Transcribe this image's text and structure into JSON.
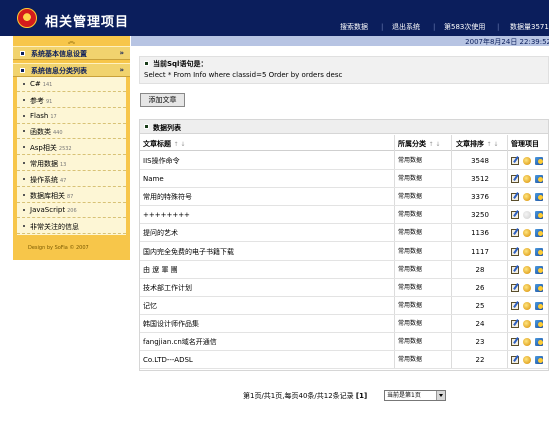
{
  "header": {
    "title": "相关管理项目",
    "nav": [
      "搜索数据",
      "退出系统",
      "第583次使用",
      "数据量3571"
    ],
    "datetime": "2007年8月24日  22:39:52"
  },
  "sidebar": {
    "collapse_icon": "chevron-double-up",
    "sections": [
      "系统基本信息设置",
      "系统信息分类列表"
    ],
    "section_chevron": "»",
    "items": [
      {
        "label": "C#",
        "count": "141"
      },
      {
        "label": "参考",
        "count": "91"
      },
      {
        "label": "Flash",
        "count": "17"
      },
      {
        "label": "函数类",
        "count": "440"
      },
      {
        "label": "Asp相关",
        "count": "2532"
      },
      {
        "label": "常用数据",
        "count": "13"
      },
      {
        "label": "操作系统",
        "count": "47"
      },
      {
        "label": "数据库相关",
        "count": "87"
      },
      {
        "label": "JavaScript",
        "count": "206"
      },
      {
        "label": "非常关注的信息",
        "count": ""
      }
    ],
    "copyright": "Design by SoFia © 2007"
  },
  "sql": {
    "heading": "当前Sql语句是：",
    "query": "Select * From Info where classid=5 Order by orders desc"
  },
  "add_button": "添加文章",
  "table": {
    "caption": "数据列表",
    "columns": [
      "文章标题",
      "所属分类",
      "文章排序",
      "管理项目"
    ],
    "sort_arrows": "↑ ↓",
    "rows": [
      {
        "title": "IIS操作命令",
        "category": "常用数据",
        "order": "3548",
        "star": true
      },
      {
        "title": "Name",
        "category": "常用数据",
        "order": "3512",
        "star": true
      },
      {
        "title": "常用的特殊符号",
        "category": "常用数据",
        "order": "3376",
        "star": true
      },
      {
        "title": "++++++++",
        "category": "常用数据",
        "order": "3250",
        "star": false
      },
      {
        "title": "提问的艺术",
        "category": "常用数据",
        "order": "1136",
        "star": true
      },
      {
        "title": "国内完全免费的电子书籍下载",
        "category": "常用数据",
        "order": "1117",
        "star": true
      },
      {
        "title": "由 遼 軍 團",
        "category": "常用数据",
        "order": "28",
        "star": true
      },
      {
        "title": "技术部工作计划",
        "category": "常用数据",
        "order": "26",
        "star": true
      },
      {
        "title": "记忆",
        "category": "常用数据",
        "order": "25",
        "star": true
      },
      {
        "title": "韩国设计师作品集",
        "category": "常用数据",
        "order": "24",
        "star": true
      },
      {
        "title": "fangjian.cn域名开通信",
        "category": "常用数据",
        "order": "23",
        "star": true
      },
      {
        "title": "Co.LTD---ADSL",
        "category": "常用数据",
        "order": "22",
        "star": true
      }
    ]
  },
  "pager": {
    "text": "第1页/共1页,每页40条/共12条记录",
    "current": "[1]",
    "select_value": "当前是第1页"
  }
}
